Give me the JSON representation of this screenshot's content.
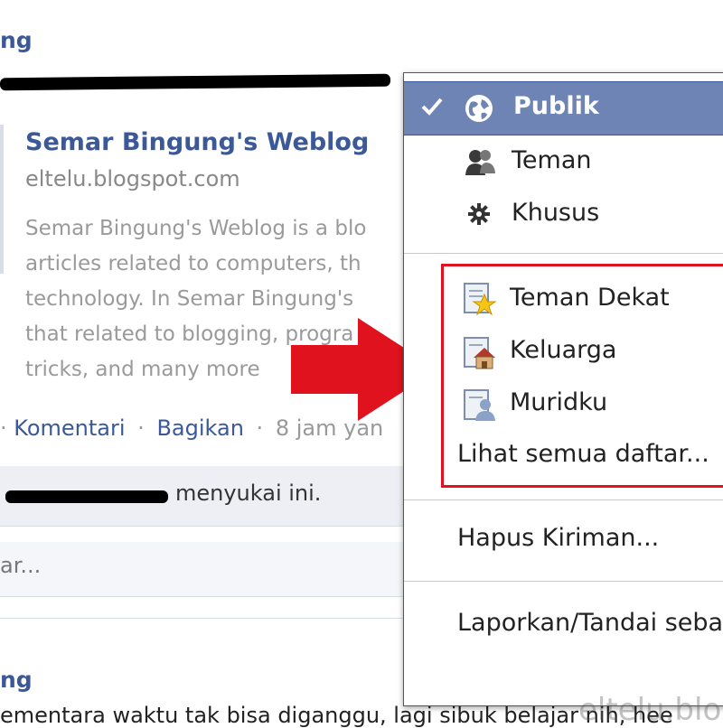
{
  "feed": {
    "poster_name": "ng",
    "link": {
      "title": "Semar Bingung's Weblog",
      "domain": "eltelu.blogspot.com",
      "description_lines": [
        "Semar Bingung's Weblog is a blo",
        "articles related to computers, th",
        "technology. In Semar Bingung's",
        "that related to blogging, progra",
        "tricks, and many more"
      ]
    },
    "actions": {
      "lead": "·",
      "comment": "Komentari",
      "share": "Bagikan",
      "time": "8 jam yan"
    },
    "likes_text": "menyukai ini.",
    "comment_placeholder": "ar...",
    "next_poster_name": "ng",
    "next_post_text": "ementara waktu tak bisa diganggu, lagi sibuk belajar nih, hee"
  },
  "menu": {
    "audience": [
      {
        "label": "Publik",
        "icon": "globe-icon",
        "selected": true
      },
      {
        "label": "Teman",
        "icon": "friends-icon",
        "selected": false
      },
      {
        "label": "Khusus",
        "icon": "gear-icon",
        "selected": false
      }
    ],
    "lists": [
      {
        "label": "Teman Dekat",
        "icon": "star-list-icon"
      },
      {
        "label": "Keluarga",
        "icon": "house-list-icon"
      },
      {
        "label": "Muridku",
        "icon": "person-list-icon"
      }
    ],
    "see_all": "Lihat semua daftar...",
    "delete": "Hapus Kiriman...",
    "report": "Laporkan/Tandai seba"
  },
  "watermark": "eltelu.blo",
  "colors": {
    "fb_blue": "#3b5998",
    "menu_highlight": "#6d84b4",
    "annotation_red": "#e0121e"
  }
}
